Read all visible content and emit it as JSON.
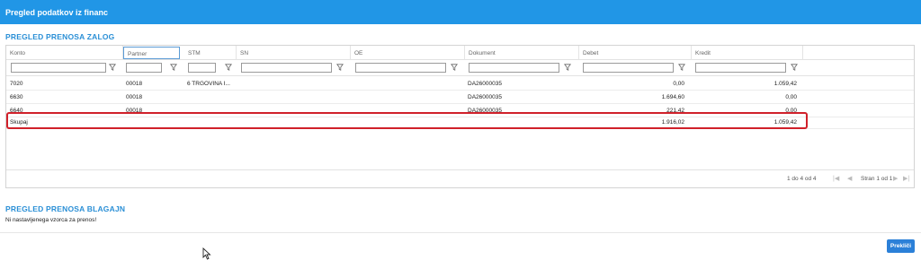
{
  "window": {
    "title": "Pregled podatkov iz financ"
  },
  "zaloge": {
    "title": "PREGLED PRENOSA ZALOG",
    "columns": [
      "Konto",
      "Partner",
      "STM",
      "SN",
      "OE",
      "Dokument",
      "Debet",
      "Kredit"
    ],
    "rows": [
      {
        "konto": "7020",
        "partner": "00018",
        "stm": "6 TRGOVINA I...",
        "sn": "",
        "oe": "",
        "dokument": "DA26000035",
        "debet": "0,00",
        "kredit": "1.059,42"
      },
      {
        "konto": "6630",
        "partner": "00018",
        "stm": "",
        "sn": "",
        "oe": "",
        "dokument": "DA26000035",
        "debet": "1.694,60",
        "kredit": "0,00"
      },
      {
        "konto": "6640",
        "partner": "00018",
        "stm": "",
        "sn": "",
        "oe": "",
        "dokument": "DA26000035",
        "debet": "221,42",
        "kredit": "0,00"
      }
    ],
    "total": {
      "label": "Skupaj",
      "debet": "1.916,02",
      "kredit": "1.059,42"
    },
    "pager": {
      "summary": "1 do 4 od 4",
      "page": "Stran 1 od 1"
    }
  },
  "blagajne": {
    "title": "PREGLED PRENOSA BLAGAJN",
    "note": "Ni nastavljenega vzorca za prenos!"
  },
  "actions": {
    "cancel": "Prekliči"
  },
  "icons": {
    "filter": "filter-icon",
    "first": "first-page-icon",
    "prev": "prev-page-icon",
    "next": "next-page-icon",
    "last": "last-page-icon",
    "cursor": "mouse-cursor-icon"
  },
  "colors": {
    "titlebar": "#2196e6",
    "section": "#2a8fd6",
    "highlight": "#d0202a",
    "button": "#2b80d8"
  }
}
